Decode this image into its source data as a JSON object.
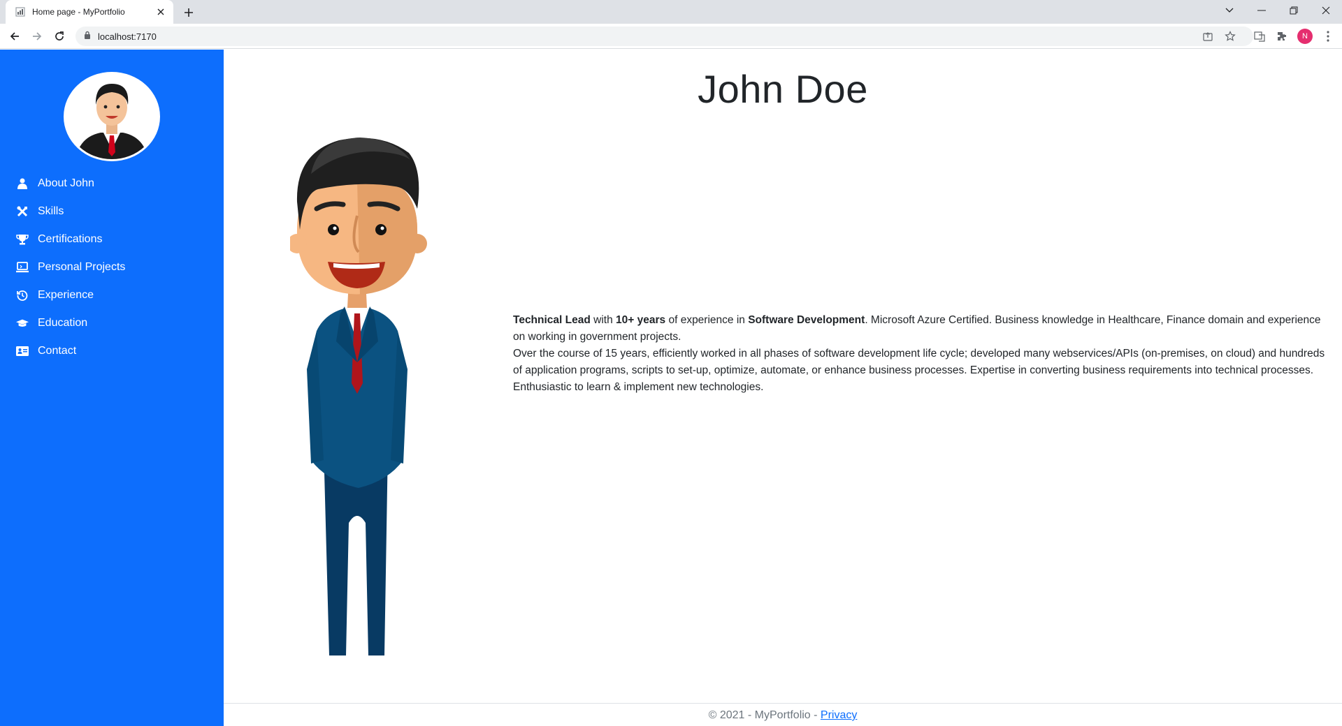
{
  "browser": {
    "tab_title": "Home page - MyPortfolio",
    "url": "localhost:7170",
    "profile_initial": "N"
  },
  "sidebar": {
    "items": [
      {
        "label": "About John",
        "icon": "user-icon"
      },
      {
        "label": "Skills",
        "icon": "tools-icon"
      },
      {
        "label": "Certifications",
        "icon": "trophy-icon"
      },
      {
        "label": "Personal Projects",
        "icon": "laptop-icon"
      },
      {
        "label": "Experience",
        "icon": "history-icon"
      },
      {
        "label": "Education",
        "icon": "graduation-cap-icon"
      },
      {
        "label": "Contact",
        "icon": "address-card-icon"
      }
    ]
  },
  "main": {
    "title": "John Doe",
    "bio": {
      "p1_b1": "Technical Lead",
      "p1_t1": " with ",
      "p1_b2": "10+ years",
      "p1_t2": " of experience in ",
      "p1_b3": "Software Development",
      "p1_t3": ". Microsoft Azure Certified. Business knowledge in Healthcare, Finance domain and experience on working in government projects.",
      "p2": "Over the course of 15 years, efficiently worked in all phases of software development life cycle; developed many webservices/APIs (on-premises, on cloud) and hundreds of application programs, scripts to set-up, optimize, automate, or enhance business processes. Expertise in converting business requirements into technical processes. Enthusiastic to learn & implement new technologies."
    }
  },
  "footer": {
    "text": "© 2021 - MyPortfolio - ",
    "privacy_label": "Privacy"
  },
  "colors": {
    "sidebar": "#0d6efd",
    "link": "#0d6efd"
  }
}
